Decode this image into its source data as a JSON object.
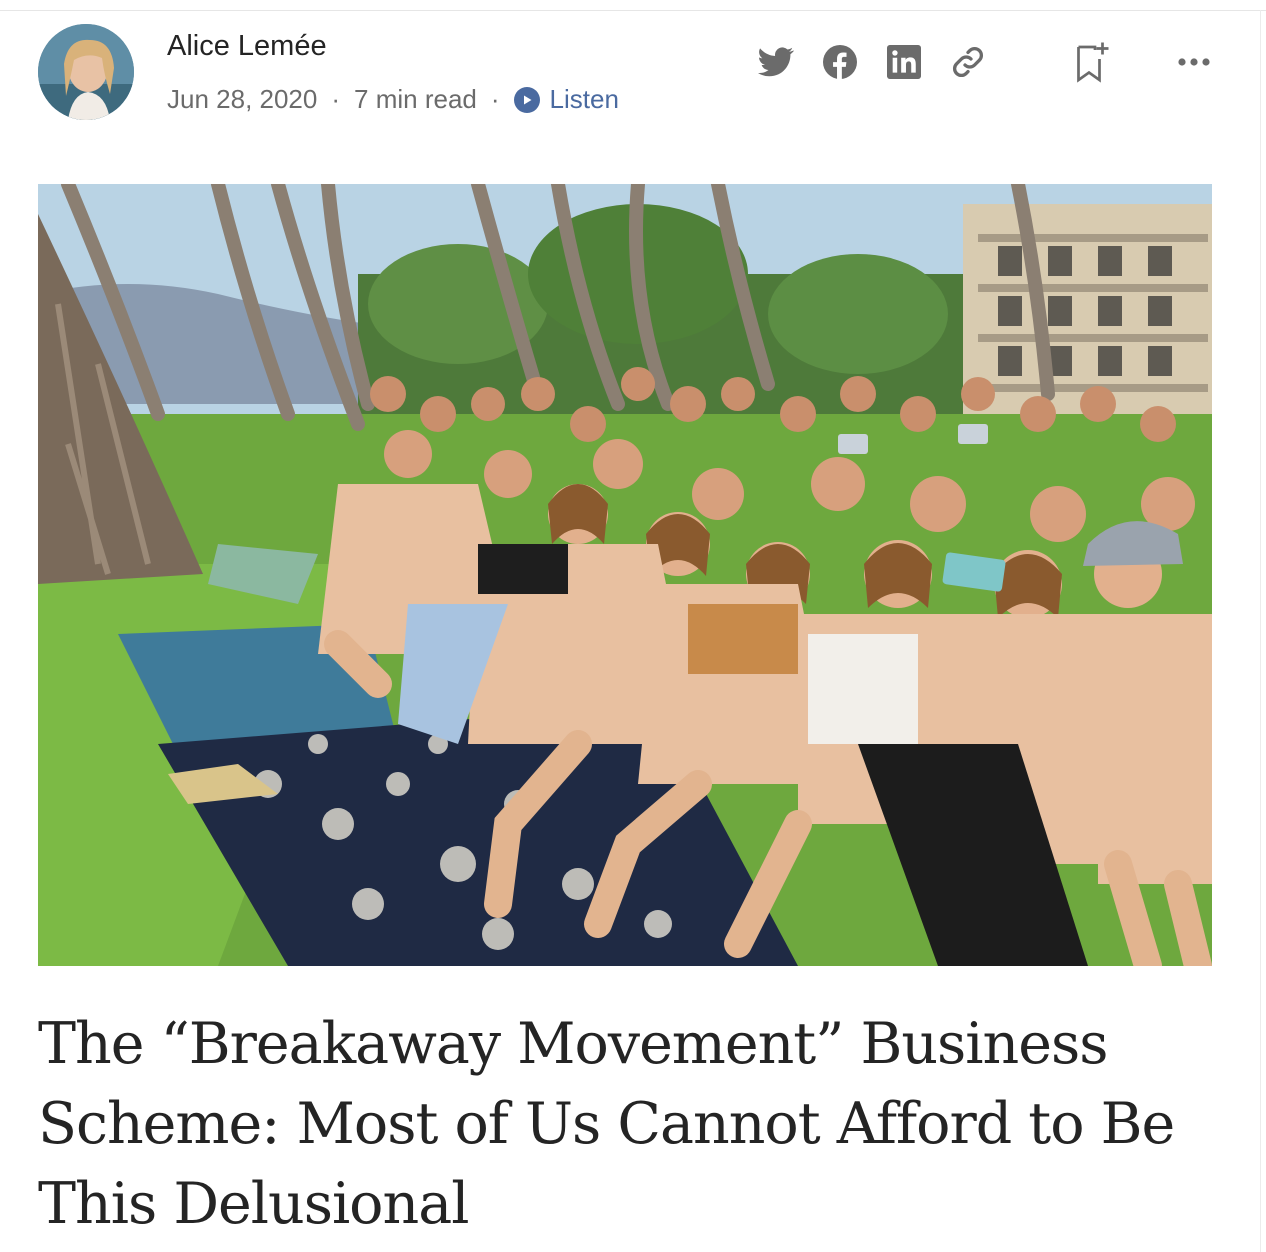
{
  "author": {
    "name": "Alice Lemée",
    "avatar_alt": "author-avatar"
  },
  "meta": {
    "date": "Jun 28, 2020",
    "separator": "·",
    "read_time": "7 min read",
    "listen_label": "Listen"
  },
  "actions": [
    {
      "name": "twitter-share-icon"
    },
    {
      "name": "facebook-share-icon"
    },
    {
      "name": "linkedin-share-icon"
    },
    {
      "name": "copy-link-icon"
    },
    {
      "name": "bookmark-add-icon"
    },
    {
      "name": "more-options-icon"
    }
  ],
  "article": {
    "title": "The “Breakaway Movement” Business Scheme: Most of Us Cannot Afford to Be This Delusional"
  },
  "colors": {
    "text": "#242424",
    "muted": "#6b6b6b",
    "accent": "#4a6aa0",
    "icon": "#6b6b6b"
  }
}
